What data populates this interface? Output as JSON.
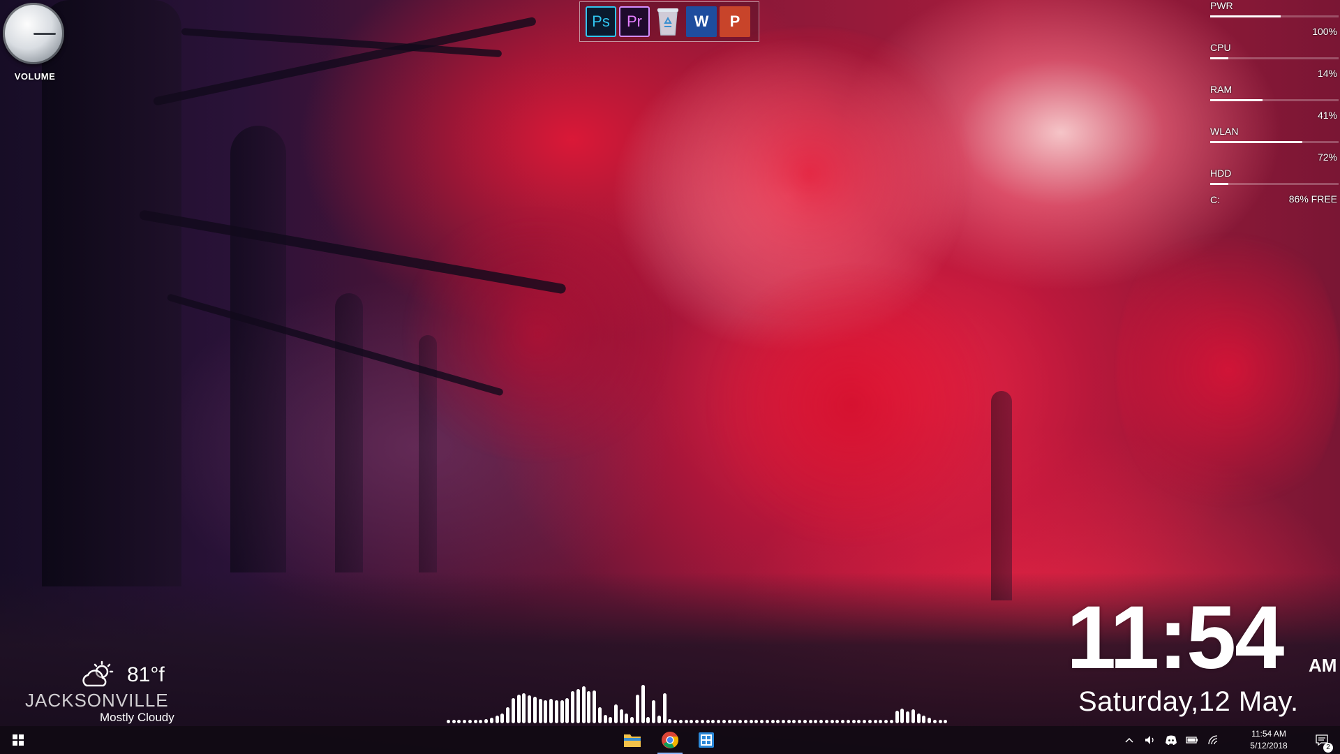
{
  "volume": {
    "label": "VOLUME"
  },
  "dock": {
    "items": [
      {
        "name": "photoshop",
        "glyph": "Ps"
      },
      {
        "name": "premiere",
        "glyph": "Pr"
      },
      {
        "name": "recycle-bin",
        "glyph": ""
      },
      {
        "name": "word",
        "glyph": "W"
      },
      {
        "name": "powerpoint",
        "glyph": "P"
      }
    ]
  },
  "sysmon": {
    "rows": [
      {
        "label": "PWR",
        "value": "100%",
        "level": 0.55
      },
      {
        "label": "CPU",
        "value": "14%",
        "level": 0.14
      },
      {
        "label": "RAM",
        "value": "41%",
        "level": 0.41
      },
      {
        "label": "WLAN",
        "value": "72%",
        "level": 0.72
      },
      {
        "label": "HDD",
        "value": "86% FREE",
        "drive": "C:",
        "level": 0.14
      }
    ]
  },
  "weather": {
    "temp": "81°f",
    "city": "JACKSONVILLE",
    "condition": "Mostly Cloudy",
    "icon": "partly-cloudy-icon"
  },
  "visualizer": {
    "levels": [
      0.06,
      0.06,
      0.06,
      0.06,
      0.06,
      0.06,
      0.06,
      0.08,
      0.1,
      0.14,
      0.18,
      0.3,
      0.48,
      0.54,
      0.56,
      0.52,
      0.5,
      0.46,
      0.44,
      0.46,
      0.44,
      0.44,
      0.48,
      0.6,
      0.64,
      0.7,
      0.6,
      0.62,
      0.3,
      0.16,
      0.12,
      0.36,
      0.26,
      0.18,
      0.12,
      0.54,
      0.72,
      0.12,
      0.44,
      0.14,
      0.56,
      0.08,
      0.06,
      0.06,
      0.06,
      0.06,
      0.06,
      0.06,
      0.06,
      0.06,
      0.06,
      0.06,
      0.06,
      0.06,
      0.06,
      0.06,
      0.06,
      0.06,
      0.06,
      0.06,
      0.06,
      0.06,
      0.06,
      0.06,
      0.06,
      0.06,
      0.06,
      0.06,
      0.06,
      0.06,
      0.06,
      0.06,
      0.06,
      0.06,
      0.06,
      0.06,
      0.06,
      0.06,
      0.06,
      0.06,
      0.06,
      0.06,
      0.06,
      0.24,
      0.28,
      0.22,
      0.26,
      0.18,
      0.14,
      0.1,
      0.06,
      0.06,
      0.06
    ]
  },
  "clock": {
    "time": "11:54",
    "ampm": "AM",
    "date": "Saturday,12 May."
  },
  "taskbar": {
    "apps": [
      {
        "name": "file-explorer",
        "active": false
      },
      {
        "name": "chrome",
        "active": true
      },
      {
        "name": "app-window",
        "active": false
      }
    ],
    "tray": {
      "time": "11:54 AM",
      "date": "5/12/2018",
      "notification_count": "2"
    }
  },
  "colors": {
    "accent": "#8ab4f8",
    "photoshop": "#31c5f0",
    "premiere": "#d58cff",
    "word": "#1e4d9e",
    "powerpoint": "#c8442a"
  }
}
